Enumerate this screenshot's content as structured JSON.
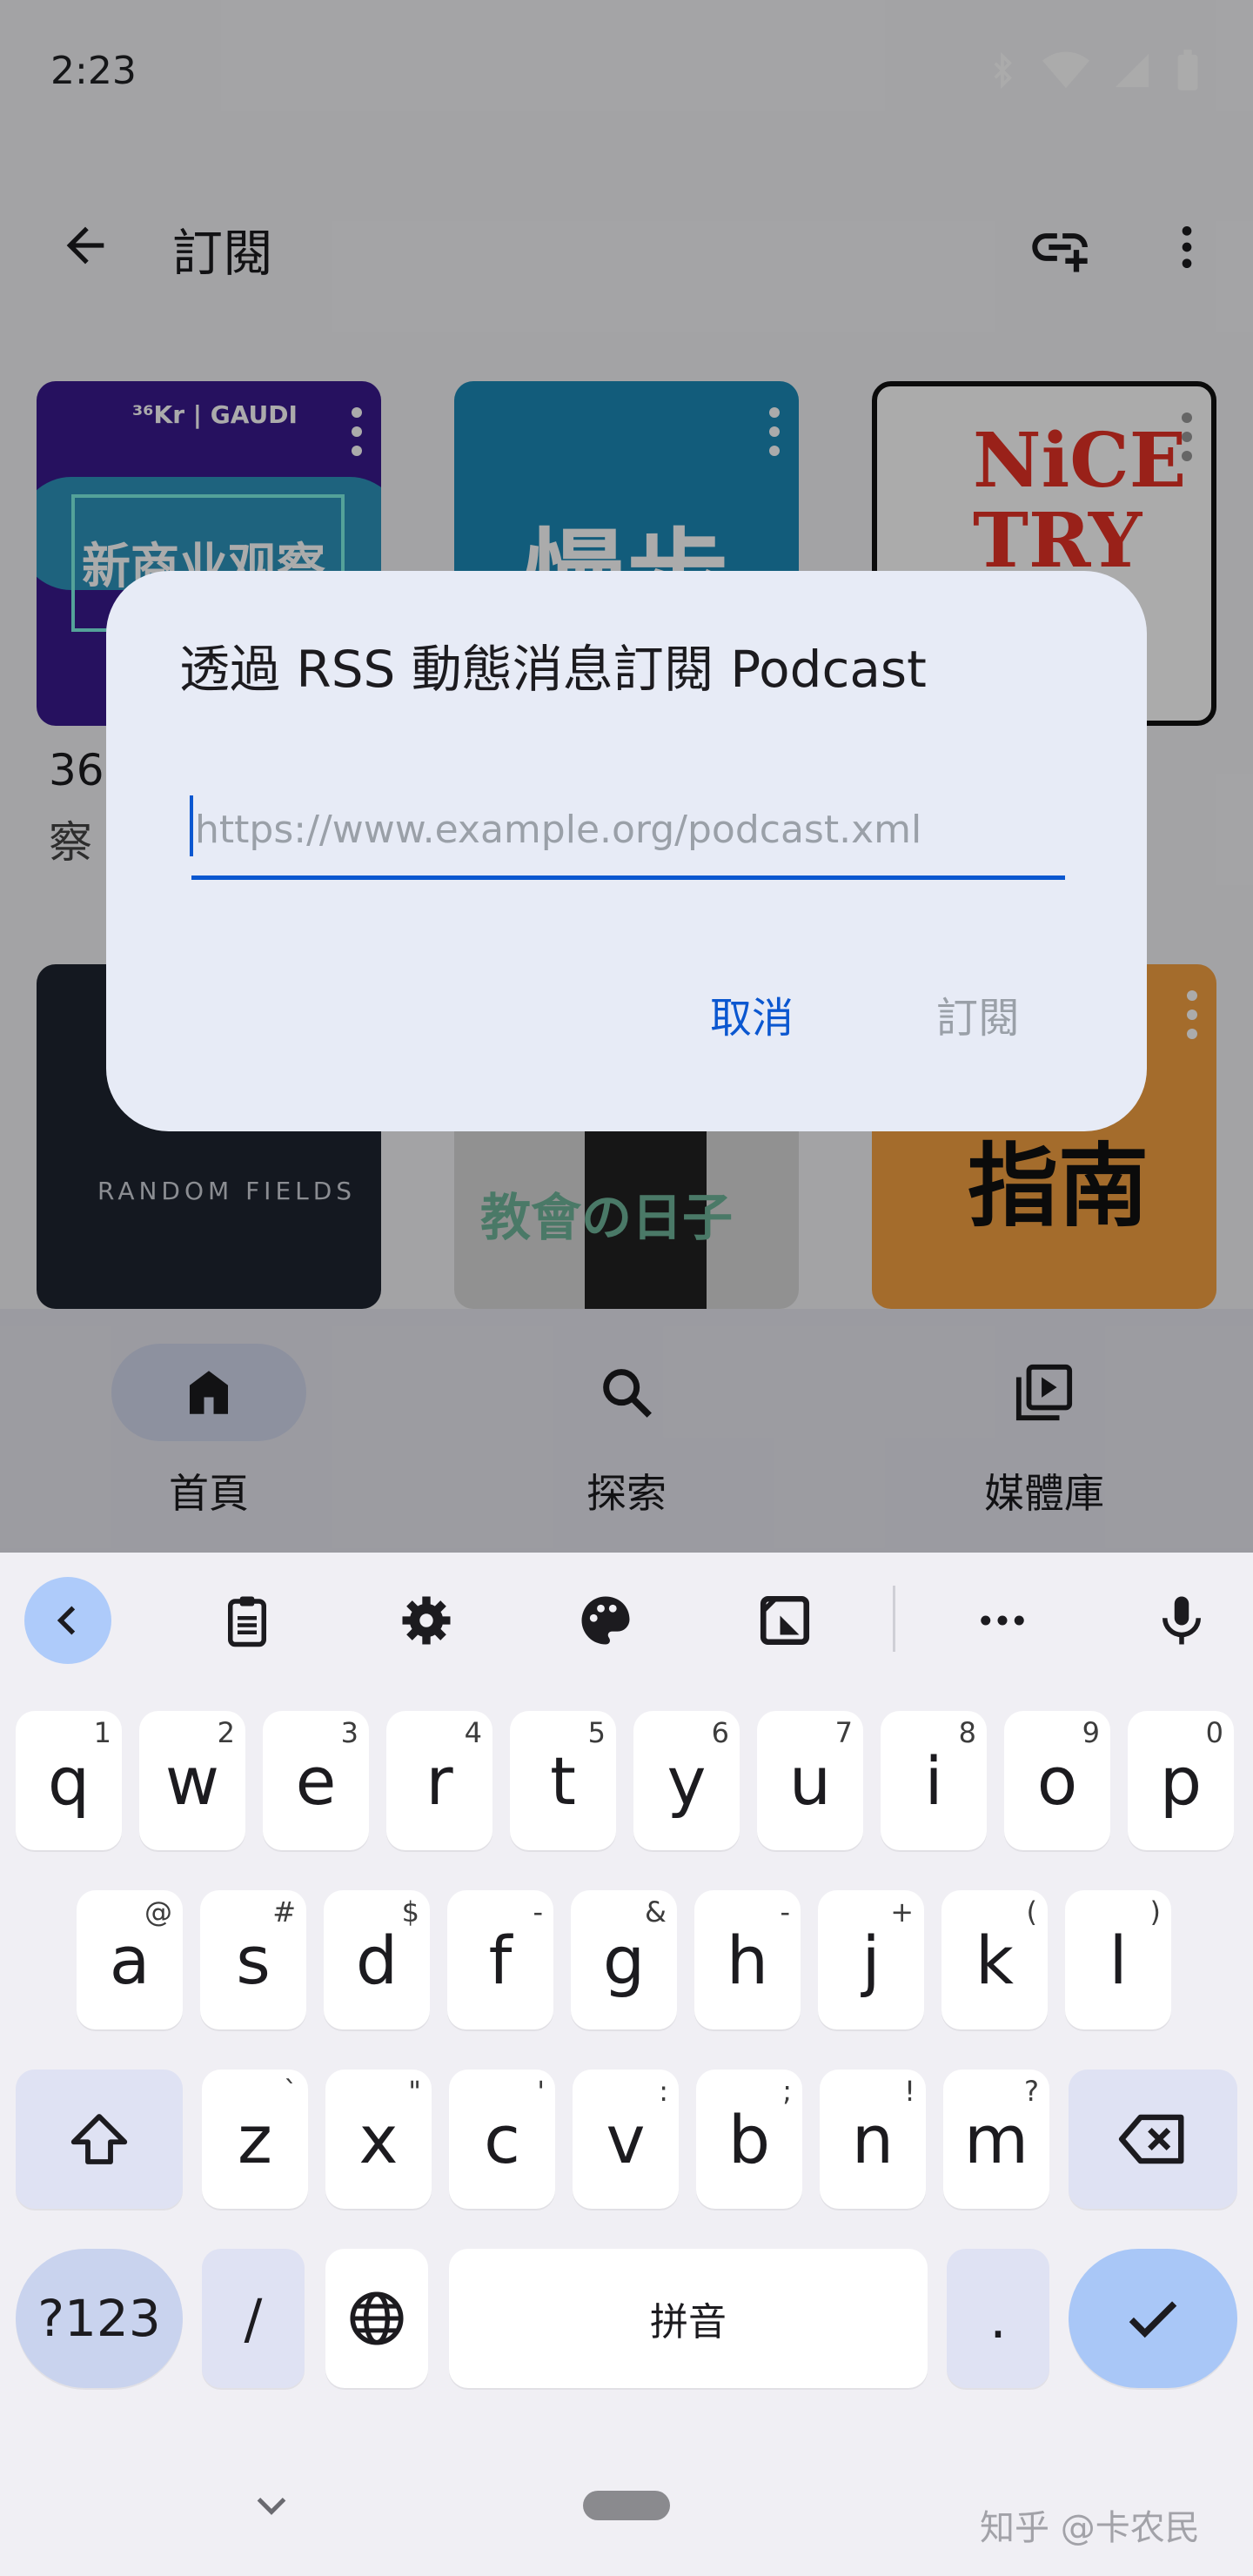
{
  "status": {
    "time": "2:23"
  },
  "app_bar": {
    "title": "訂閱"
  },
  "grid": {
    "tiles": [
      {
        "art_top": "³⁶Kr | GAUDI",
        "art_main": "新商业观察",
        "color": "#3a1a8e"
      },
      {
        "art_main": "慢步",
        "color": "#1b8ab8"
      },
      {
        "art_main": "NiCE TRY",
        "color": "#ffffff"
      },
      {
        "art_main": "RANDOM FIELDS",
        "color": "#1f2430"
      },
      {
        "art_main": "教會の日子",
        "color": "#d9d9d9"
      },
      {
        "art_main": "指南",
        "color": "#f5a142"
      }
    ],
    "row1_title_fragment": "36",
    "row1_sub_fragment": "察"
  },
  "bottom_nav": {
    "items": [
      {
        "label": "首頁",
        "icon": "home-icon",
        "active": true
      },
      {
        "label": "探索",
        "icon": "search-icon",
        "active": false
      },
      {
        "label": "媒體庫",
        "icon": "library-icon",
        "active": false
      }
    ]
  },
  "dialog": {
    "title": "透過 RSS 動態消息訂閱 Podcast",
    "input_placeholder": "https://www.example.org/podcast.xml",
    "input_value": "",
    "cancel_label": "取消",
    "subscribe_label": "訂閱",
    "accent": "#0b57d0"
  },
  "keyboard": {
    "row1": [
      {
        "k": "q",
        "h": "1"
      },
      {
        "k": "w",
        "h": "2"
      },
      {
        "k": "e",
        "h": "3"
      },
      {
        "k": "r",
        "h": "4"
      },
      {
        "k": "t",
        "h": "5"
      },
      {
        "k": "y",
        "h": "6"
      },
      {
        "k": "u",
        "h": "7"
      },
      {
        "k": "i",
        "h": "8"
      },
      {
        "k": "o",
        "h": "9"
      },
      {
        "k": "p",
        "h": "0"
      }
    ],
    "row2": [
      {
        "k": "a",
        "h": "@"
      },
      {
        "k": "s",
        "h": "#"
      },
      {
        "k": "d",
        "h": "$"
      },
      {
        "k": "f",
        "h": "-"
      },
      {
        "k": "g",
        "h": "&"
      },
      {
        "k": "h",
        "h": "-"
      },
      {
        "k": "j",
        "h": "+"
      },
      {
        "k": "k",
        "h": "("
      },
      {
        "k": "l",
        "h": ")"
      }
    ],
    "row3": [
      {
        "k": "z",
        "h": "`"
      },
      {
        "k": "x",
        "h": "\""
      },
      {
        "k": "c",
        "h": "'"
      },
      {
        "k": "v",
        "h": ":"
      },
      {
        "k": "b",
        "h": ";"
      },
      {
        "k": "n",
        "h": "!"
      },
      {
        "k": "m",
        "h": "?"
      }
    ],
    "sym_label": "?123",
    "slash_label": "/",
    "space_label": "拼音",
    "period_label": "."
  },
  "watermark": "知乎 @卡农民"
}
